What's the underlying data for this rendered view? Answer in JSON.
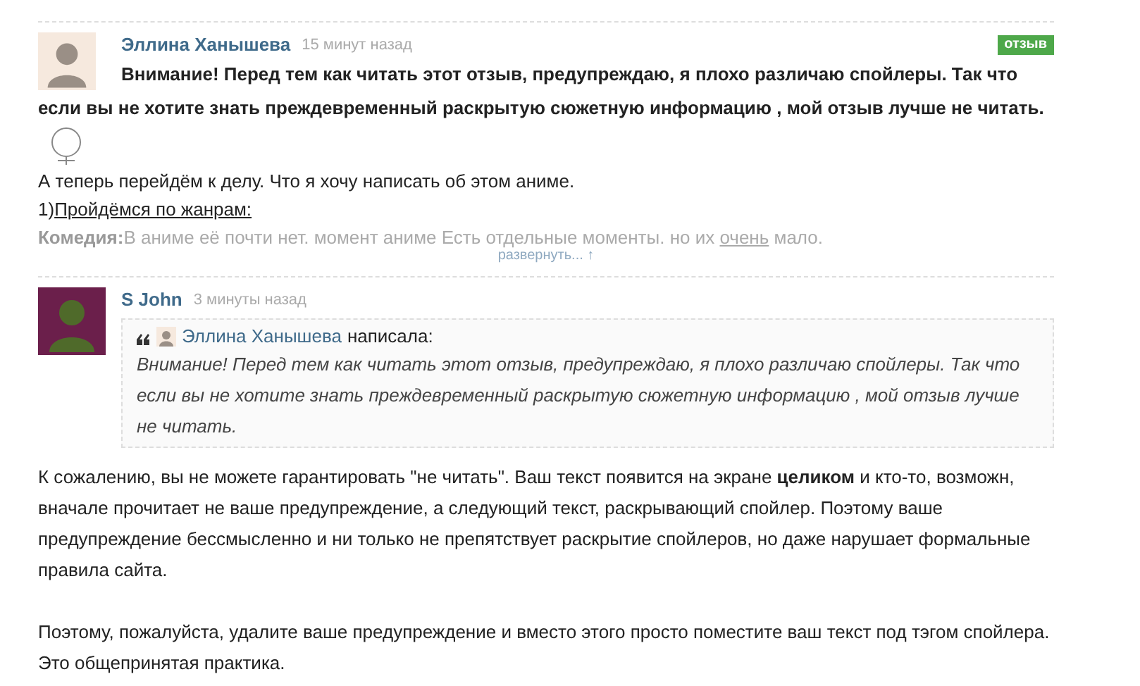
{
  "comments": [
    {
      "author": "Эллина Ханышева",
      "time": "15 минут назад",
      "badge": "отзыв",
      "warning": "Внимание! Перед тем как читать этот отзыв, предупреждаю, я плохо различаю спойлеры. Так что если вы не хотите знать преждевременный раскрытую сюжетную информацию , мой отзыв лучше не читать.",
      "lines": [
        "А теперь перейдём к делу. Что я хочу написать об этом аниме."
      ],
      "section": {
        "prefix": "1)",
        "title": "Пройдёмся по жанрам:"
      },
      "genre": {
        "label": "Комедия:",
        "before": "В аниме её почти нет. момент аниме Есть отдельные моменты. но их ",
        "link": "очень",
        "after": " мало."
      },
      "expand": "развернуть... ↑"
    },
    {
      "author": "S John",
      "time": "3 минуты назад",
      "quote": {
        "author": "Эллина Ханышева",
        "verb": "написала:",
        "text": "Внимание! Перед тем как читать этот отзыв, предупреждаю, я плохо различаю спойлеры. Так что если вы не хотите знать преждевременный раскрытую сюжетную информацию , мой отзыв лучше не читать."
      },
      "paragraphs": [
        "К сожалению, вы не можете гарантировать \"не читать\". Ваш текст появится на экране **целиком** и кто-то, возможн, вначале прочитает не ваше предупреждение, а следующий текст, раскрывающий спойлер. Поэтому ваше предупреждение бессмысленно и ни только не препятствует раскрытие спойлеров, но даже нарушает формальные правила сайта.",
        "Поэтому, пожалуйста, удалите ваше предупреждение и вместо этого просто поместите ваш текст под тэгом спойлера. Это общепринятая практика."
      ]
    }
  ]
}
